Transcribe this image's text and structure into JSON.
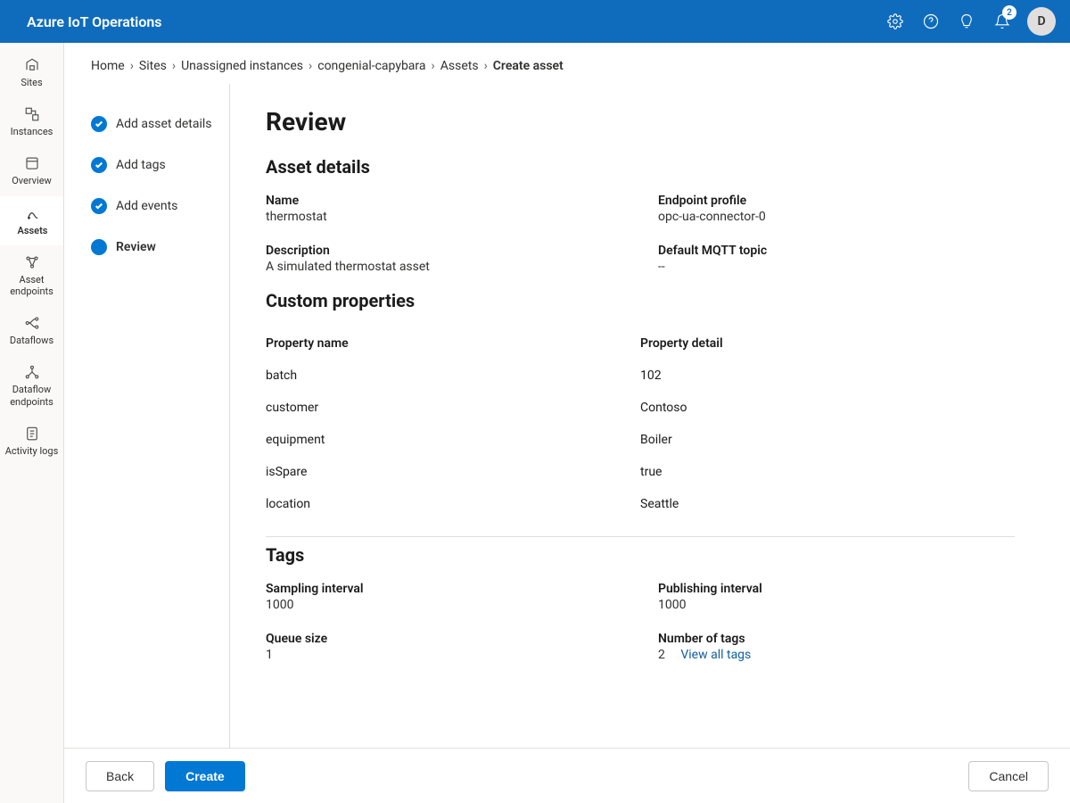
{
  "app": {
    "title": "Azure IoT Operations",
    "notification_count": "2",
    "avatar_initial": "D"
  },
  "left_rail": {
    "items": [
      {
        "label": "Sites"
      },
      {
        "label": "Instances"
      },
      {
        "label": "Overview"
      },
      {
        "label": "Assets"
      },
      {
        "label": "Asset endpoints"
      },
      {
        "label": "Dataflows"
      },
      {
        "label": "Dataflow endpoints"
      },
      {
        "label": "Activity logs"
      }
    ]
  },
  "breadcrumb": {
    "items": [
      "Home",
      "Sites",
      "Unassigned instances",
      "congenial-capybara",
      "Assets",
      "Create asset"
    ]
  },
  "stepper": {
    "steps": [
      {
        "label": "Add asset details"
      },
      {
        "label": "Add tags"
      },
      {
        "label": "Add events"
      },
      {
        "label": "Review"
      }
    ]
  },
  "review": {
    "title": "Review",
    "asset_details": {
      "heading": "Asset details",
      "name_label": "Name",
      "name_value": "thermostat",
      "endpoint_label": "Endpoint profile",
      "endpoint_value": "opc-ua-connector-0",
      "description_label": "Description",
      "description_value": "A simulated thermostat asset",
      "mqtt_label": "Default MQTT topic",
      "mqtt_value": "--"
    },
    "custom_props": {
      "heading": "Custom properties",
      "col_name": "Property name",
      "col_detail": "Property detail",
      "rows": [
        {
          "name": "batch",
          "detail": "102"
        },
        {
          "name": "customer",
          "detail": "Contoso"
        },
        {
          "name": "equipment",
          "detail": "Boiler"
        },
        {
          "name": "isSpare",
          "detail": "true"
        },
        {
          "name": "location",
          "detail": "Seattle"
        }
      ]
    },
    "tags": {
      "heading": "Tags",
      "sampling_label": "Sampling interval",
      "sampling_value": "1000",
      "publishing_label": "Publishing interval",
      "publishing_value": "1000",
      "queue_label": "Queue size",
      "queue_value": "1",
      "count_label": "Number of tags",
      "count_value": "2",
      "view_all": "View all tags"
    }
  },
  "footer": {
    "back": "Back",
    "create": "Create",
    "cancel": "Cancel"
  }
}
